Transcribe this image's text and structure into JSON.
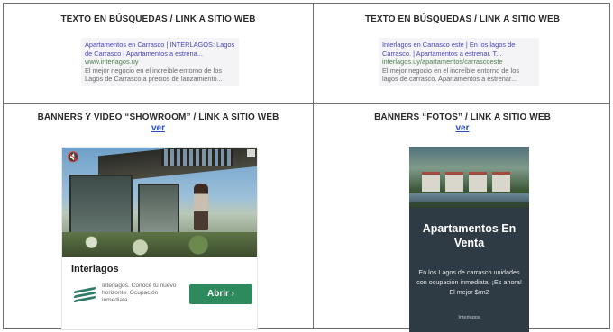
{
  "cells": {
    "search_left": {
      "heading": "TEXTO EN BÚSQUEDAS / LINK A SITIO WEB",
      "ad_title": "Apartamentos en Carrasco | INTERLAGOS: Lagos de Carrasco | Apartamentos a estrena...",
      "ad_url": "www.interlagos.uy",
      "ad_desc": "El mejor negocio en el increíble entorno de los Lagos de Carrasco a precios de lanzamiento..."
    },
    "search_right": {
      "heading": "TEXTO EN BÚSQUEDAS / LINK A SITIO WEB",
      "ad_title": "Interlagos en Carrasco este | En los lagos de Carrasco. | Apartamentos a estrenar. T...",
      "ad_url": "interlagos.uy/apartamentos/carrascoeste",
      "ad_desc": "El mejor negocio en el increíble entorno de los lagos de carrasco. Apartamentos a estrenar..."
    },
    "showroom": {
      "heading": "BANNERS Y VIDEO “SHOWROOM” / LINK A SITIO WEB",
      "link": "ver",
      "brand": "Interlagos",
      "subtext": "Interlagos. Conocé tu nuevo horizonte. Ocupación inmediata...",
      "cta": "Abrir ›"
    },
    "fotos": {
      "heading": "BANNERS “FOTOS” / LINK A SITIO WEB",
      "link": "ver",
      "title": "Apartamentos En Venta",
      "description": "En los Lagos de carrasco unidades con ocupación inmediata. ¡Es ahora! El mejor $/m2",
      "small": "Interlagos"
    }
  },
  "colors": {
    "border": "#6f6f6f",
    "link": "#2a4fc0",
    "cta_green": "#2c8a5c",
    "fotos_bg": "#2e3a44"
  },
  "icons": [
    "mute-icon",
    "adchoices-icon",
    "interlagos-logo-icon"
  ]
}
